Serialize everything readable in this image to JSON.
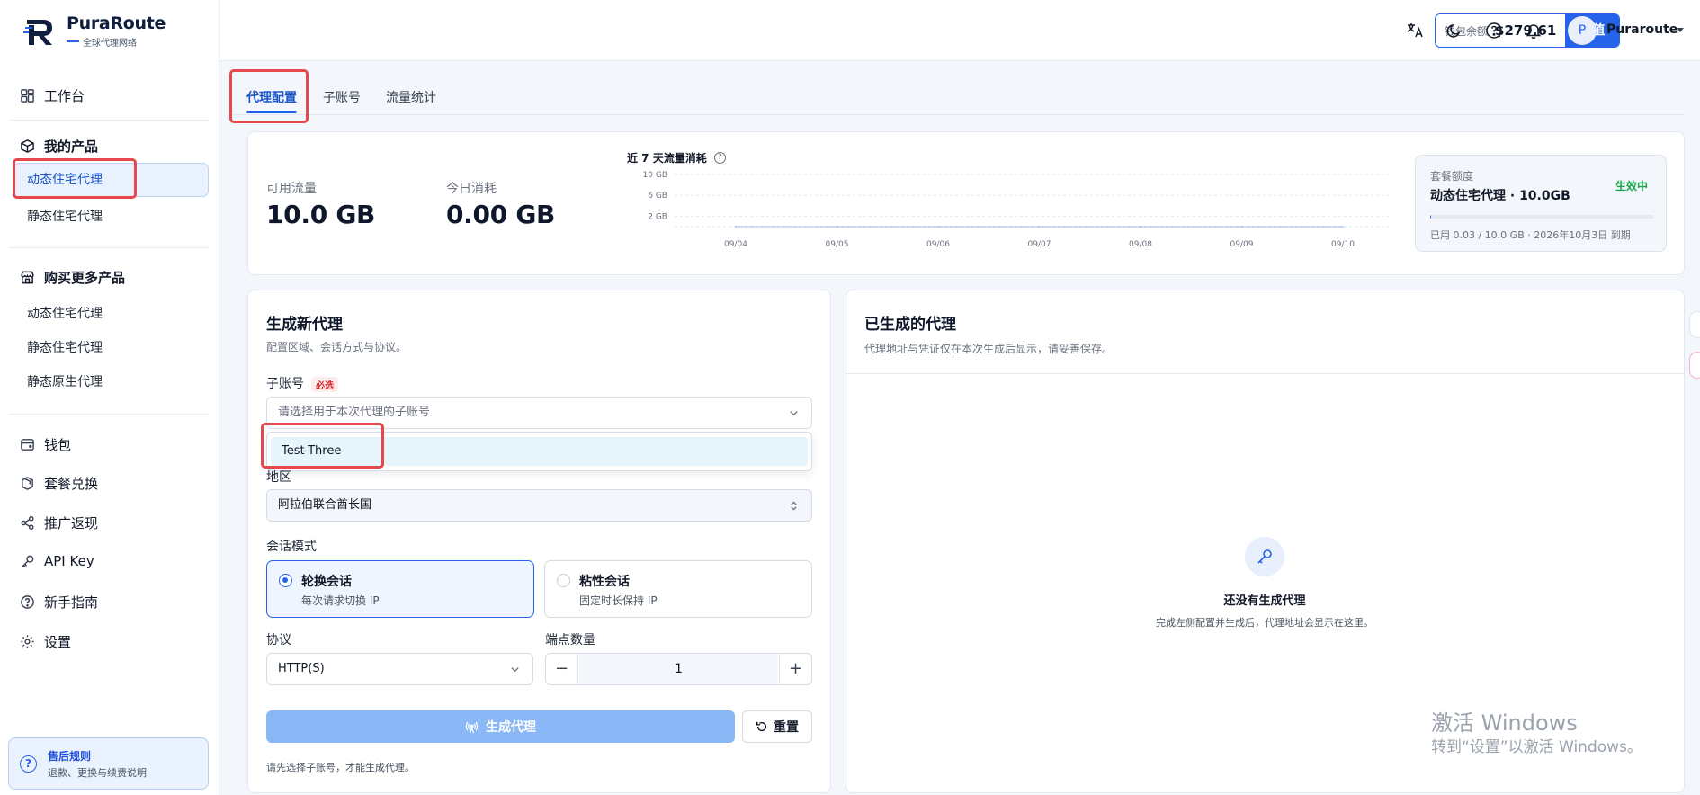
{
  "brand": {
    "name": "PuraRoute",
    "tagline": "全球代理网络"
  },
  "sidebar": {
    "workbench": "工作台",
    "my_products": "我的产品",
    "my_products_items": [
      "动态住宅代理",
      "静态住宅代理"
    ],
    "buy_more": "购买更多产品",
    "buy_more_items": [
      "动态住宅代理",
      "静态住宅代理",
      "静态原生代理"
    ],
    "menu": [
      "钱包",
      "套餐兑换",
      "推广返现",
      "API Key",
      "新手指南",
      "设置"
    ],
    "after_sale": {
      "title": "售后规则",
      "desc": "退款、更换与续费说明"
    }
  },
  "topbar": {
    "wallet_label": "钱包余额",
    "wallet_amount": "$279.61",
    "recharge": "充值",
    "avatar_initial": "P",
    "username": "Puraroute"
  },
  "tabs": [
    "代理配置",
    "子账号",
    "流量统计"
  ],
  "stats": {
    "available_label": "可用流量",
    "available_value": "10.0 GB",
    "today_label": "今日消耗",
    "today_value": "0.00 GB",
    "chart_title": "近 7 天流量消耗"
  },
  "chart_data": {
    "type": "line",
    "title": "近 7 天流量消耗",
    "x": [
      "09/04",
      "09/05",
      "09/06",
      "09/07",
      "09/08",
      "09/09",
      "09/10"
    ],
    "y_ticks": [
      "10 GB",
      "6 GB",
      "2 GB"
    ],
    "ylim": [
      0,
      10
    ],
    "series": [
      {
        "values": [
          0.03,
          0,
          0,
          0,
          0,
          0,
          0
        ]
      }
    ],
    "grid": true
  },
  "plan": {
    "label": "套餐额度",
    "name": "动态住宅代理 · 10.0GB",
    "status": "生效中",
    "usage_fraction": 0.003,
    "detail": "已用 0.03 / 10.0 GB · 2026年10月3日 到期"
  },
  "form": {
    "title": "生成新代理",
    "subtitle": "配置区域、会话方式与协议。",
    "sub_account_label": "子账号",
    "required_badge": "必选",
    "sub_account_placeholder": "请选择用于本次代理的子账号",
    "dropdown_option": "Test-Three",
    "region_label": "地区",
    "region_value": "阿拉伯联合酋长国",
    "session_label": "会话模式",
    "session_rotating": {
      "title": "轮换会话",
      "desc": "每次请求切换 IP"
    },
    "session_sticky": {
      "title": "粘性会话",
      "desc": "固定时长保持 IP"
    },
    "protocol_label": "协议",
    "protocol_value": "HTTP(S)",
    "endpoints_label": "端点数量",
    "endpoints_minus": "−",
    "endpoints_value": "1",
    "endpoints_plus": "+",
    "generate": "生成代理",
    "reset": "重置",
    "hint": "请先选择子账号，才能生成代理。"
  },
  "generated": {
    "title": "已生成的代理",
    "subtitle": "代理地址与凭证仅在本次生成后显示，请妥善保存。",
    "empty_title": "还没有生成代理",
    "empty_desc": "完成左侧配置并生成后，代理地址会显示在这里。"
  },
  "watermark": {
    "line1": "激活 Windows",
    "line2": "转到“设置”以激活 Windows。"
  },
  "colors": {
    "accent": "#2563eb",
    "highlight": "#e5484d",
    "success": "#16a34a"
  }
}
